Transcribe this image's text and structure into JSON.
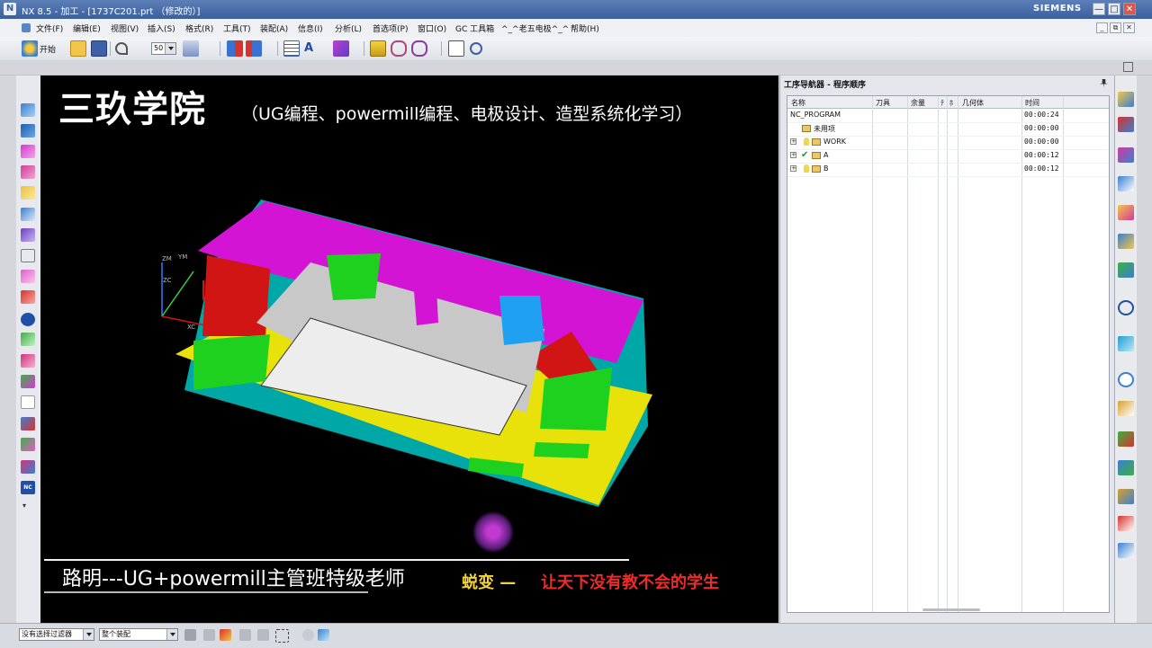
{
  "window": {
    "title": "NX 8.5 - 加工 - [1737C201.prt （修改的）]",
    "logo_text": "N",
    "brand": "SIEMENS",
    "buttons": [
      "—",
      "□",
      "✕"
    ]
  },
  "menu": {
    "items": [
      "文件(F)",
      "编辑(E)",
      "视图(V)",
      "插入(S)",
      "格式(R)",
      "工具(T)",
      "装配(A)",
      "信息(I)",
      "分析(L)",
      "首选项(P)",
      "窗口(O)",
      "GC 工具箱",
      "^_^老五电极^_^",
      "帮助(H)"
    ],
    "mdi_buttons": [
      "_",
      "⧉",
      "✕"
    ]
  },
  "toolbar": {
    "start_label": "开始",
    "zoom_value": "50"
  },
  "viewport": {
    "title": "三玖学院",
    "subtitle": "（UG编程、powermill编程、电极设计、造型系统化学习）",
    "teacher_line": "路明---UG+powermill主管班特级老师",
    "slogan_a": "蜕变 —",
    "slogan_b": "让天下没有教不会的学生",
    "axes": {
      "zm": "ZM",
      "ym": "YM",
      "xc": "XC",
      "zc": "ZC"
    }
  },
  "navigator": {
    "title": "工序导航器 - 程序顺序",
    "columns": [
      "名称",
      "刀具",
      "余量",
      "ﾃ",
      "ﾎ",
      "几何体",
      "时间"
    ],
    "rows": [
      {
        "name": "NC_PROGRAM",
        "time": "00:00:24",
        "indent": 0,
        "icon": "none",
        "expander": false
      },
      {
        "name": "未用项",
        "time": "00:00:00",
        "indent": 1,
        "icon": "folder",
        "expander": false
      },
      {
        "name": "WORK",
        "time": "00:00:00",
        "indent": 1,
        "icon": "bulb",
        "expander": true
      },
      {
        "name": "A",
        "time": "00:00:12",
        "indent": 1,
        "icon": "check",
        "expander": true
      },
      {
        "name": "B",
        "time": "00:00:12",
        "indent": 1,
        "icon": "bulb",
        "expander": true
      }
    ]
  },
  "status": {
    "filter_value": "没有选择过滤器",
    "scope_value": "整个装配"
  }
}
